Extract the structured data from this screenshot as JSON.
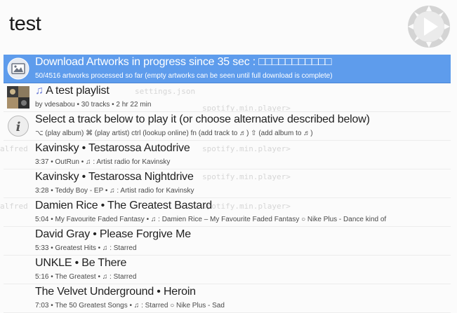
{
  "search": {
    "query": "test"
  },
  "results": [
    {
      "title": "Download Artworks in progress since 35 sec : □□□□□□□□□□□",
      "subtitle": "50/4516 artworks processed so far (empty artworks can be seen until full download is complete)",
      "icon": "artwork-download-icon",
      "selected": true
    },
    {
      "title": "A test playlist",
      "subtitle": "by vdesabou • 30 tracks • 2 hr 22 min",
      "icon": "playlist-cover-icon",
      "title_icon": "music-note-icon"
    },
    {
      "title": "Select a track below to play it (or choose alternative described below)",
      "subtitle": "⌥ (play album) ⌘ (play artist) ctrl (lookup online) fn (add track to ♬) ⇧ (add album to ♬)",
      "icon": "info-icon"
    },
    {
      "title": "Kavinsky • Testarossa Autodrive",
      "subtitle": "3:37 • OutRun • ♫ : Artist radio for Kavinsky"
    },
    {
      "title": "Kavinsky • Testarossa Nightdrive",
      "subtitle": "3:28 • Teddy Boy - EP • ♫ : Artist radio for Kavinsky"
    },
    {
      "title": "Damien Rice • The Greatest Bastard",
      "subtitle": "5:04 • My Favourite Faded Fantasy • ♫ : Damien Rice – My Favourite Faded Fantasy ○ Nike Plus - Dance kind of"
    },
    {
      "title": "David Gray • Please Forgive Me",
      "subtitle": "5:33 • Greatest Hits • ♫ : Starred"
    },
    {
      "title": "UNKLE • Be There",
      "subtitle": "5:16 • The Greatest • ♫ : Starred"
    },
    {
      "title": "The Velvet Underground • Heroin",
      "subtitle": "7:03 • The 50 Greatest Songs • ♫ : Starred ○ Nike Plus - Sad"
    }
  ],
  "background_ghost": {
    "lines": [
      "settings.json",
      "spotify.min.player>",
      "alfred",
      "spotify.min.player>",
      "spotify.min.player>",
      "alfred",
      "spotify.min.player>"
    ]
  },
  "colors": {
    "selected_bg": "#5e9cec",
    "text": "#222222",
    "subtext": "#4a4a4a"
  }
}
